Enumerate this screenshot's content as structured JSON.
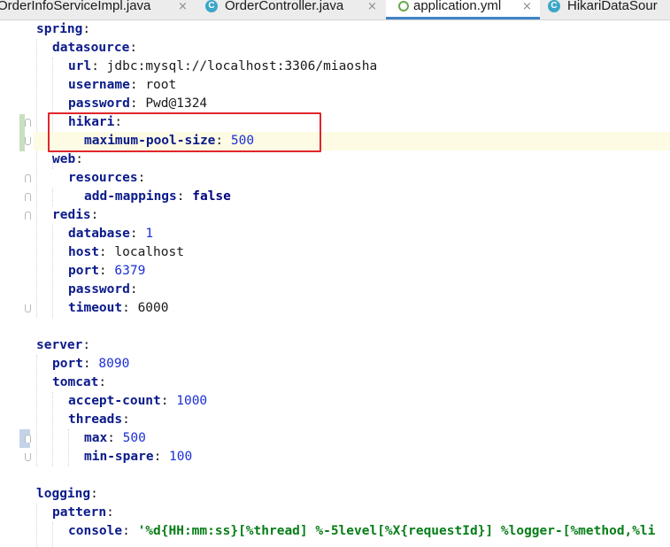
{
  "tabs": [
    {
      "label": "OrderInfoServiceImpl.java",
      "close": "×",
      "icon": "java-class-icon"
    },
    {
      "label": "OrderController.java",
      "close": "×",
      "icon": "java-class-icon",
      "icon_letter": "C"
    },
    {
      "label": "application.yml",
      "close": "×",
      "icon": "yml-leaf-icon",
      "active": true
    },
    {
      "label": "HikariDataSour",
      "icon": "java-class-icon",
      "icon_letter": "C"
    }
  ],
  "code": [
    {
      "key": "spring",
      "sep": ":",
      "value": ""
    },
    {
      "key": "datasource",
      "sep": ":",
      "value": ""
    },
    {
      "key": "url",
      "sep": ":",
      "value": "jdbc:mysql://localhost:3306/miaosha",
      "type": "str"
    },
    {
      "key": "username",
      "sep": ":",
      "value": "root",
      "type": "str"
    },
    {
      "key": "password",
      "sep": ":",
      "value": "Pwd@1324",
      "type": "str"
    },
    {
      "key": "hikari",
      "sep": ":",
      "value": ""
    },
    {
      "key": "maximum-pool-size",
      "sep": ":",
      "value": "500",
      "type": "num"
    },
    {
      "key": "web",
      "sep": ":",
      "value": ""
    },
    {
      "key": "resources",
      "sep": ":",
      "value": ""
    },
    {
      "key": "add-mappings",
      "sep": ":",
      "value": "false",
      "type": "bool"
    },
    {
      "key": "redis",
      "sep": ":",
      "value": ""
    },
    {
      "key": "database",
      "sep": ":",
      "value": "1",
      "type": "num"
    },
    {
      "key": "host",
      "sep": ":",
      "value": "localhost",
      "type": "str"
    },
    {
      "key": "port",
      "sep": ":",
      "value": "6379",
      "type": "num"
    },
    {
      "key": "password",
      "sep": ":",
      "value": "",
      "type": "str"
    },
    {
      "key": "timeout",
      "sep": ":",
      "value": "6000",
      "type": "str"
    },
    {
      "key": "",
      "sep": "",
      "value": ""
    },
    {
      "key": "server",
      "sep": ":",
      "value": ""
    },
    {
      "key": "port",
      "sep": ":",
      "value": "8090",
      "type": "num"
    },
    {
      "key": "tomcat",
      "sep": ":",
      "value": ""
    },
    {
      "key": "accept-count",
      "sep": ":",
      "value": "1000",
      "type": "num"
    },
    {
      "key": "threads",
      "sep": ":",
      "value": ""
    },
    {
      "key": "max",
      "sep": ":",
      "value": "500",
      "type": "num"
    },
    {
      "key": "min-spare",
      "sep": ":",
      "value": "100",
      "type": "num"
    },
    {
      "key": "",
      "sep": "",
      "value": ""
    },
    {
      "key": "logging",
      "sep": ":",
      "value": ""
    },
    {
      "key": "pattern",
      "sep": ":",
      "value": ""
    },
    {
      "key": "console",
      "sep": ":",
      "value": "'%d{HH:mm:ss}[%thread] %-5level[%X{requestId}] %logger-[%method,%li",
      "type": "quoted"
    }
  ],
  "colors": {
    "key": "#0a1a8a",
    "number": "#1c2fd6",
    "quoted_string": "#067d17",
    "highlight_box": "#e0262c",
    "current_line": "#fdfbe4",
    "active_tab_underline": "#4083c9"
  }
}
